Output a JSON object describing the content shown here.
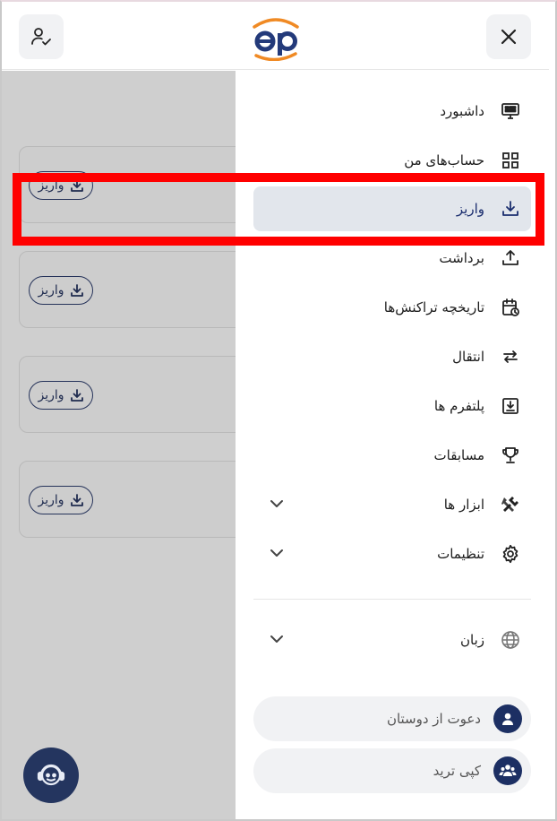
{
  "menu": {
    "items": [
      {
        "label": "داشبورد",
        "icon": "monitor-icon"
      },
      {
        "label": "حساب‌های من",
        "icon": "grid-icon"
      },
      {
        "label": "واریز",
        "icon": "download-icon",
        "active": true
      },
      {
        "label": "برداشت",
        "icon": "upload-icon"
      },
      {
        "label": "تاریخچه تراکنش‌ها",
        "icon": "calendar-clock-icon"
      },
      {
        "label": "انتقال",
        "icon": "transfer-icon"
      },
      {
        "label": "پلتفرم ها",
        "icon": "platform-download-icon"
      },
      {
        "label": "مسابقات",
        "icon": "trophy-icon"
      },
      {
        "label": "ابزار ها",
        "icon": "tools-icon"
      },
      {
        "label": "تنظیمات",
        "icon": "gear-icon"
      }
    ],
    "language_label": "زبان",
    "invite_label": "دعوت از دوستان",
    "copy_trade_label": "کپی ترید"
  },
  "background": {
    "deposit_label": "واریز"
  },
  "colors": {
    "accent": "#1c2f63",
    "active_bg": "#e2e6ec",
    "highlight": "#ff0000"
  }
}
